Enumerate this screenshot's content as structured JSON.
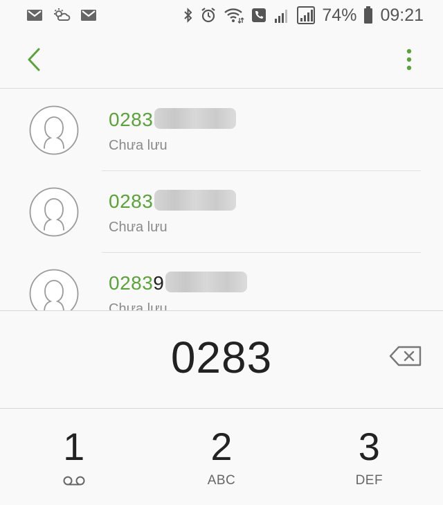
{
  "status_bar": {
    "left_icons": [
      "gmail-icon",
      "weather-icon",
      "gmail-icon"
    ],
    "right_icons": [
      "bluetooth-icon",
      "alarm-icon",
      "wifi-icon",
      "call-icon",
      "signal-icon",
      "signal-icon"
    ],
    "battery_percent": "74%",
    "time": "09:21"
  },
  "toolbar": {
    "back_icon": "chevron-left-icon",
    "more_icon": "more-vert-icon",
    "accent_color": "#5aa33a"
  },
  "results": [
    {
      "number_match": "0283",
      "number_rest": "",
      "label": "Chưa lưu"
    },
    {
      "number_match": "0283",
      "number_rest": "",
      "label": "Chưa lưu"
    },
    {
      "number_match": "0283",
      "number_rest": "9",
      "label": "Chưa lưu"
    }
  ],
  "dialer": {
    "number": "0283",
    "backspace_icon": "backspace-icon"
  },
  "keypad": {
    "keys": [
      {
        "digit": "1",
        "letters": "",
        "icon": "voicemail-icon"
      },
      {
        "digit": "2",
        "letters": "ABC"
      },
      {
        "digit": "3",
        "letters": "DEF"
      }
    ]
  }
}
